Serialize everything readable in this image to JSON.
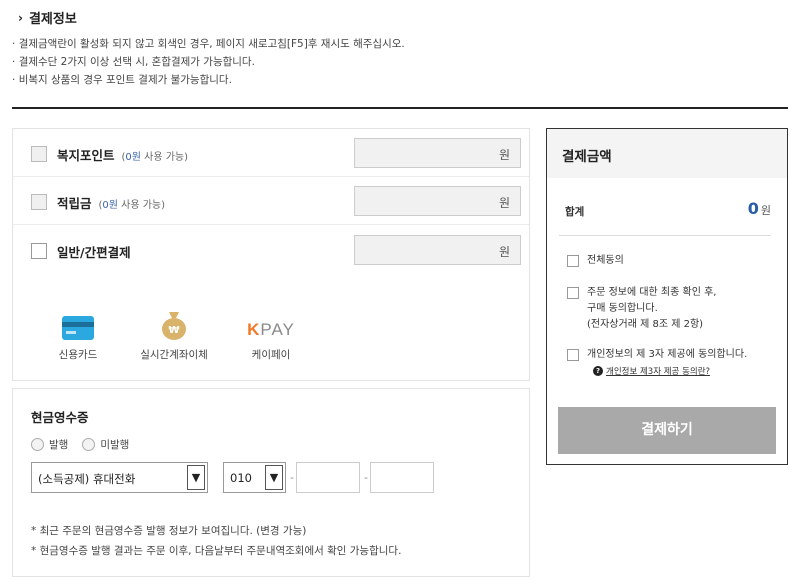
{
  "section": {
    "title": "결제정보",
    "notes": [
      "결제금액란이 활성화 되지 않고 회색인 경우, 페이지 새로고침[F5]후 재시도 해주십시오.",
      "결제수단 2가지 이상 선택 시, 혼합결제가 가능합니다.",
      "비복지 상품의 경우 포인트 결제가 불가능합니다."
    ]
  },
  "payment": {
    "rows": [
      {
        "label": "복지포인트",
        "sub_prefix": "(",
        "sub_value": "0원",
        "sub_suffix": " 사용 가능)",
        "unit": "원"
      },
      {
        "label": "적립금",
        "sub_prefix": "(",
        "sub_value": "0원",
        "sub_suffix": " 사용 가능)",
        "unit": "원"
      },
      {
        "label": "일반/간편결제",
        "unit": "원"
      }
    ],
    "methods": [
      {
        "label": "신용카드",
        "icon": "credit-card-icon"
      },
      {
        "label": "실시간계좌이체",
        "icon": "money-bag-icon"
      },
      {
        "label": "케이페이",
        "icon": "kpay-logo"
      }
    ],
    "kpay_logo_k": "K",
    "kpay_logo_pay": "PAY"
  },
  "cash_receipt": {
    "title": "현금영수증",
    "options": [
      "발행",
      "미발행"
    ],
    "type_select": "(소득공제) 휴대전화",
    "phone_prefix": "010",
    "dash": "-",
    "notes": [
      "최근 주문의 현금영수증 발행 정보가 보여집니다. (변경 가능)",
      "현금영수증 발행 결과는 주문 이후, 다음날부터 주문내역조회에서 확인 가능합니다."
    ]
  },
  "summary": {
    "title": "결제금액",
    "total_label": "합계",
    "total_value": "0",
    "total_unit": "원",
    "agree_all": "전체동의",
    "agree_order_1": "주문 정보에 대한 최종 확인 후,",
    "agree_order_2": "구매 동의합니다.",
    "agree_order_3": "(전자상거래 제 8조 제 2항)",
    "agree_privacy": "개인정보의 제 3자 제공에 동의합니다.",
    "privacy_link": "개인정보 제3자 제공 동의란?",
    "pay_button": "결제하기"
  },
  "colors": {
    "accent_blue": "#2a5da8",
    "pay_button_bg": "#a9a9a9",
    "card_icon": "#2aa8df",
    "bag_icon": "#d9b36a",
    "kpay_orange": "#f07a2a",
    "kpay_gray": "#8a8a8a"
  }
}
